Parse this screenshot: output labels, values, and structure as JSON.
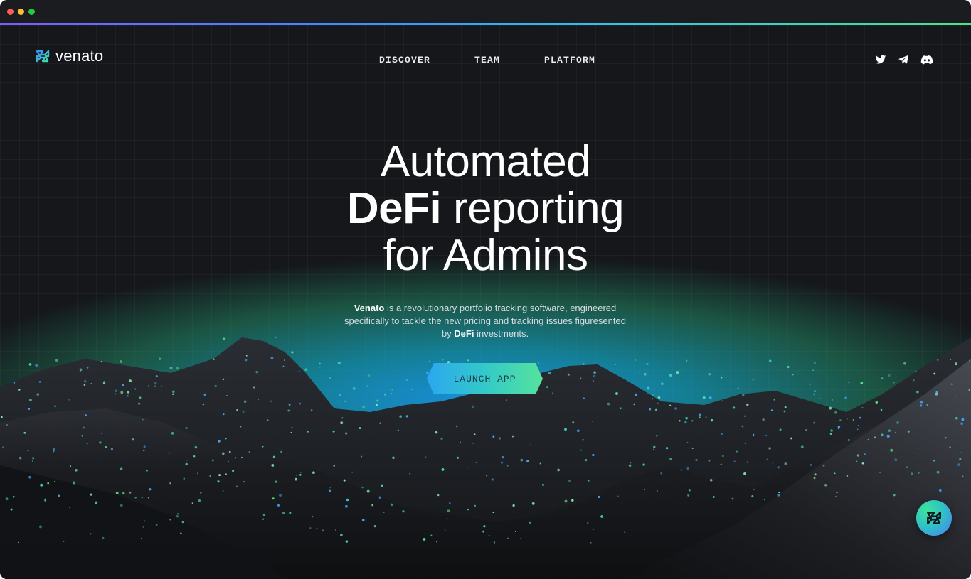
{
  "colors": {
    "background": "#15171b",
    "accent_blue": "#2ba7f0",
    "accent_teal": "#33c9c9",
    "accent_green": "#55e39c",
    "text": "#ffffff"
  },
  "brand": {
    "name": "venato",
    "logo_icon": "venato-logo-icon"
  },
  "nav": {
    "items": [
      {
        "label": "DISCOVER"
      },
      {
        "label": "TEAM"
      },
      {
        "label": "PLATFORM"
      }
    ]
  },
  "social": [
    {
      "icon": "twitter-icon"
    },
    {
      "icon": "telegram-icon"
    },
    {
      "icon": "discord-icon"
    }
  ],
  "hero": {
    "line1": "Automated",
    "line2_bold": "DeFi",
    "line2_rest": "reporting",
    "line3": "for Admins",
    "desc_brand": "Venato",
    "desc_part1": "is a revolutionary portfolio tracking software, engineered specifically to tackle the new pricing and tracking issues figuresented by",
    "desc_bold": "DeFi",
    "desc_part2": "investments."
  },
  "cta": {
    "label": "LAUNCH APP"
  },
  "fab": {
    "icon": "venato-chat-icon"
  }
}
